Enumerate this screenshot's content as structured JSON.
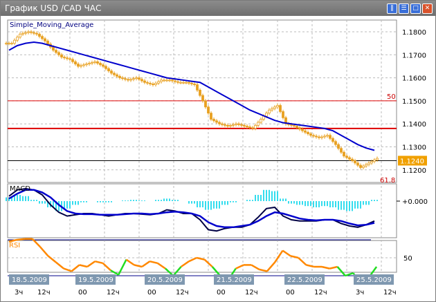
{
  "window": {
    "title": "График USD /CAD  ЧАС",
    "buttons": [
      "pause",
      "restore",
      "maximize",
      "close"
    ]
  },
  "main": {
    "indicator": "Simple_Moving_Average",
    "price_ticks": [
      "1.1800",
      "1.1700",
      "1.1600",
      "1.1500",
      "1.1400",
      "1.1300",
      "1.1200"
    ],
    "current_price": "1.1240",
    "fib_labels": [
      "50",
      "61.8"
    ],
    "red_level": 1.138,
    "fib50_level": 1.15,
    "current_level": 1.124,
    "closes": [
      1.175,
      1.179,
      1.18,
      1.179,
      1.176,
      1.172,
      1.169,
      1.168,
      1.165,
      1.166,
      1.167,
      1.165,
      1.162,
      1.16,
      1.159,
      1.16,
      1.158,
      1.157,
      1.159,
      1.159,
      1.158,
      1.158,
      1.157,
      1.15,
      1.142,
      1.14,
      1.139,
      1.14,
      1.139,
      1.138,
      1.142,
      1.146,
      1.148,
      1.14,
      1.139,
      1.137,
      1.135,
      1.134,
      1.135,
      1.131,
      1.126,
      1.124,
      1.121,
      1.123,
      1.125
    ],
    "sma": [
      1.172,
      1.174,
      1.175,
      1.1755,
      1.175,
      1.174,
      1.173,
      1.172,
      1.171,
      1.17,
      1.169,
      1.168,
      1.167,
      1.166,
      1.165,
      1.164,
      1.163,
      1.162,
      1.161,
      1.16,
      1.1595,
      1.159,
      1.1585,
      1.158,
      1.156,
      1.154,
      1.152,
      1.15,
      1.148,
      1.146,
      1.1445,
      1.143,
      1.1415,
      1.1405,
      1.14,
      1.1395,
      1.139,
      1.1385,
      1.138,
      1.137,
      1.135,
      1.133,
      1.131,
      1.1295,
      1.1285
    ]
  },
  "macd": {
    "label": "MACD",
    "zero_label": "+0.000",
    "main": [
      0.4,
      0.9,
      1.0,
      0.9,
      0.5,
      -0.3,
      -0.9,
      -1.2,
      -1.1,
      -1.0,
      -1.0,
      -1.1,
      -1.2,
      -1.1,
      -1.0,
      -1.0,
      -1.05,
      -1.1,
      -1.0,
      -0.7,
      -0.8,
      -1.0,
      -1.0,
      -1.5,
      -2.3,
      -2.4,
      -2.2,
      -2.1,
      -2.1,
      -1.9,
      -1.3,
      -0.6,
      -0.5,
      -1.2,
      -1.5,
      -1.6,
      -1.6,
      -1.6,
      -1.5,
      -1.5,
      -1.8,
      -2.0,
      -2.1,
      -1.9,
      -1.6
    ],
    "signal": [
      0.2,
      0.6,
      0.9,
      0.9,
      0.7,
      0.3,
      -0.3,
      -0.8,
      -1.0,
      -1.05,
      -1.05,
      -1.1,
      -1.1,
      -1.1,
      -1.05,
      -1.0,
      -1.0,
      -1.05,
      -1.0,
      -0.9,
      -0.85,
      -0.9,
      -1.0,
      -1.2,
      -1.7,
      -2.0,
      -2.1,
      -2.1,
      -2.0,
      -1.9,
      -1.6,
      -1.2,
      -0.9,
      -1.0,
      -1.2,
      -1.4,
      -1.5,
      -1.55,
      -1.5,
      -1.5,
      -1.6,
      -1.8,
      -1.95,
      -1.9,
      -1.75
    ],
    "hist": [
      0.3,
      0.5,
      0.4,
      0.1,
      -0.2,
      -0.5,
      -0.8,
      -0.6,
      -0.3,
      -0.1,
      0.0,
      -0.1,
      -0.1,
      0.0,
      0.05,
      0.1,
      0.05,
      0.0,
      0.1,
      0.2,
      0.1,
      0.0,
      -0.2,
      -0.5,
      -0.7,
      -0.6,
      -0.3,
      -0.1,
      0.0,
      0.1,
      0.5,
      0.9,
      0.8,
      0.2,
      -0.2,
      -0.3,
      -0.4,
      -0.5,
      -0.4,
      -0.5,
      -0.7,
      -0.8,
      -0.6,
      -0.3,
      0.1
    ]
  },
  "rsi": {
    "label": "RSI",
    "tick": "50",
    "values": [
      68,
      70,
      71,
      71,
      62,
      52,
      45,
      38,
      35,
      42,
      40,
      46,
      44,
      36,
      31,
      48,
      42,
      40,
      46,
      44,
      38,
      30,
      40,
      46,
      50,
      48,
      40,
      30,
      25,
      38,
      42,
      42,
      37,
      35,
      45,
      58,
      52,
      50,
      42,
      40,
      40,
      38,
      40,
      30,
      33,
      22,
      28,
      40
    ]
  },
  "time_axis": {
    "dates": [
      "18.5.2009",
      "19.5.2009",
      "20.5.2009",
      "21.5.2009",
      "22.5.2009",
      "25.5.2009"
    ],
    "hours": [
      "3ч",
      "12ч",
      "00",
      "12ч",
      "00",
      "12ч",
      "00",
      "12ч",
      "00",
      "12ч",
      "3ч",
      "12ч"
    ]
  },
  "colors": {
    "candle": "#e8a020",
    "sma": "#0000cc",
    "macd_main": "#000044",
    "macd_hist": "#33ddee",
    "rsi": "#ff8800",
    "rsi_low": "#22dd22",
    "level": "#dd0000",
    "price_badge": "#f0a000",
    "date_badge": "#7f98b0"
  }
}
